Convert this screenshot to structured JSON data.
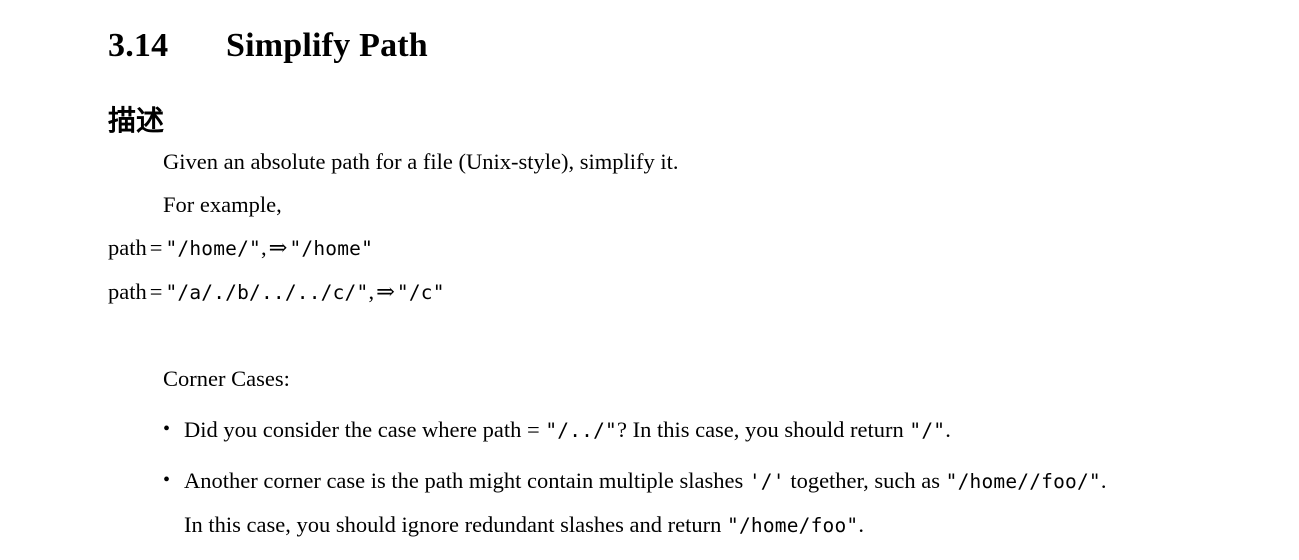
{
  "document": {
    "section_number": "3.14",
    "section_title": "Simplify Path",
    "subsection_title": "描述",
    "description_line_1": "Given an absolute path for a file (Unix-style), simplify it.",
    "description_line_2": "For example,",
    "examples": [
      {
        "label": "path",
        "equals": "=",
        "input": "\"/home/\"",
        "comma": ",",
        "arrow": "⇒",
        "output": "\"/home\""
      },
      {
        "label": "path",
        "equals": "=",
        "input": "\"/a/./b/../../c/\"",
        "comma": ",",
        "arrow": "⇒",
        "output": "\"/c\""
      }
    ],
    "corner_cases_title": "Corner Cases:",
    "bullet_marker": "•",
    "corner_cases": [
      {
        "lines": [
          [
            {
              "type": "text",
              "value": "Did you consider the case where path = "
            },
            {
              "type": "code",
              "value": "\"/../\""
            },
            {
              "type": "text",
              "value": "? In this case, you should return "
            },
            {
              "type": "code",
              "value": "\"/\""
            },
            {
              "type": "text",
              "value": "."
            }
          ]
        ]
      },
      {
        "lines": [
          [
            {
              "type": "text",
              "value": "Another corner case is the path might contain multiple slashes "
            },
            {
              "type": "code",
              "value": "'/'"
            },
            {
              "type": "text",
              "value": " together, such as "
            },
            {
              "type": "code",
              "value": "\"/home//foo/\""
            },
            {
              "type": "text",
              "value": "."
            }
          ],
          [
            {
              "type": "text",
              "value": "In this case, you should ignore redundant slashes and return "
            },
            {
              "type": "code",
              "value": "\"/home/foo\""
            },
            {
              "type": "text",
              "value": "."
            }
          ]
        ]
      }
    ]
  },
  "colors": {
    "page_background": "#ffffff",
    "text": "#000000"
  }
}
